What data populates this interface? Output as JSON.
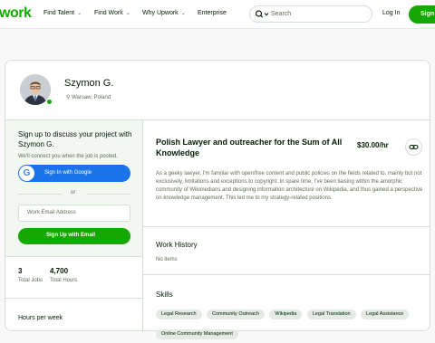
{
  "header": {
    "logo": "work",
    "nav": [
      {
        "label": "Find Talent"
      },
      {
        "label": "Find Work"
      },
      {
        "label": "Why Upwork"
      },
      {
        "label": "Enterprise"
      }
    ],
    "search_placeholder": "Search",
    "login": "Log In",
    "signup": "Sign"
  },
  "profile": {
    "name": "Szymon G.",
    "location": "Warsaw, Poland"
  },
  "sidebar": {
    "title": "Sign up to discuss your project with Szymon G.",
    "subtitle": "We'll connect you when the job is posted.",
    "google_btn": "Sign In with Google",
    "or": "or",
    "email_placeholder": "Work Email Address",
    "email_btn": "Sign Up with Email",
    "stats": [
      {
        "value": "3",
        "label": "Total Jobs"
      },
      {
        "value": "4,700",
        "label": "Total Hours"
      }
    ],
    "hours_title": "Hours per week"
  },
  "main": {
    "title": "Polish Lawyer and outreacher for the Sum of All Knowledge",
    "rate": "$30.00/hr",
    "description": "As a geeky lawyer, I'm familiar with open/free content and public policies on the fields related to, mainly but not exclusively, limitations and exceptions to copyright. In spare time, I've been liaising within the amorphic community of Wikimedians and designing information architecture on Wikipedia, and thus gained a perspective on knowledge management. This led me to my strategy-related positions.",
    "work_history_title": "Work History",
    "work_history_empty": "No items",
    "skills_title": "Skills",
    "skills": [
      "Legal Research",
      "Community Outreach",
      "Wikipedia",
      "Legal Translation",
      "Legal Assistance",
      "Online Community Management"
    ]
  },
  "colors": {
    "brand": "#14a800",
    "google": "#1a73e8"
  }
}
